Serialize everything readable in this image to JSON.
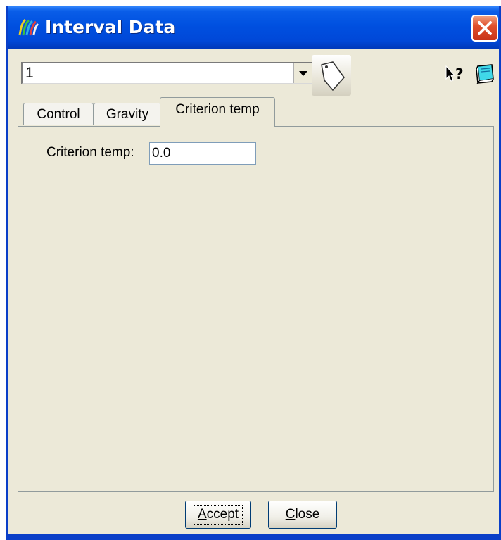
{
  "window": {
    "title": "Interval Data",
    "colors": {
      "titlebar": "#0050e0",
      "face": "#ece9d8",
      "close": "#e0502c"
    }
  },
  "toolbar": {
    "selector_value": "1",
    "icons": [
      "app-icon",
      "dropdown-arrow-icon",
      "tag-icon",
      "whats-this-help-icon",
      "manual-book-icon"
    ]
  },
  "tabs": [
    {
      "label": "Control",
      "active": false
    },
    {
      "label": "Gravity",
      "active": false
    },
    {
      "label": "Criterion temp",
      "active": true
    }
  ],
  "criterion_tab": {
    "field_label": "Criterion temp:",
    "field_value": "0.0"
  },
  "buttons": {
    "accept": {
      "label_prefix": "",
      "mnemonic": "A",
      "label_rest": "ccept"
    },
    "close": {
      "mnemonic": "C",
      "label_rest": "lose"
    }
  }
}
